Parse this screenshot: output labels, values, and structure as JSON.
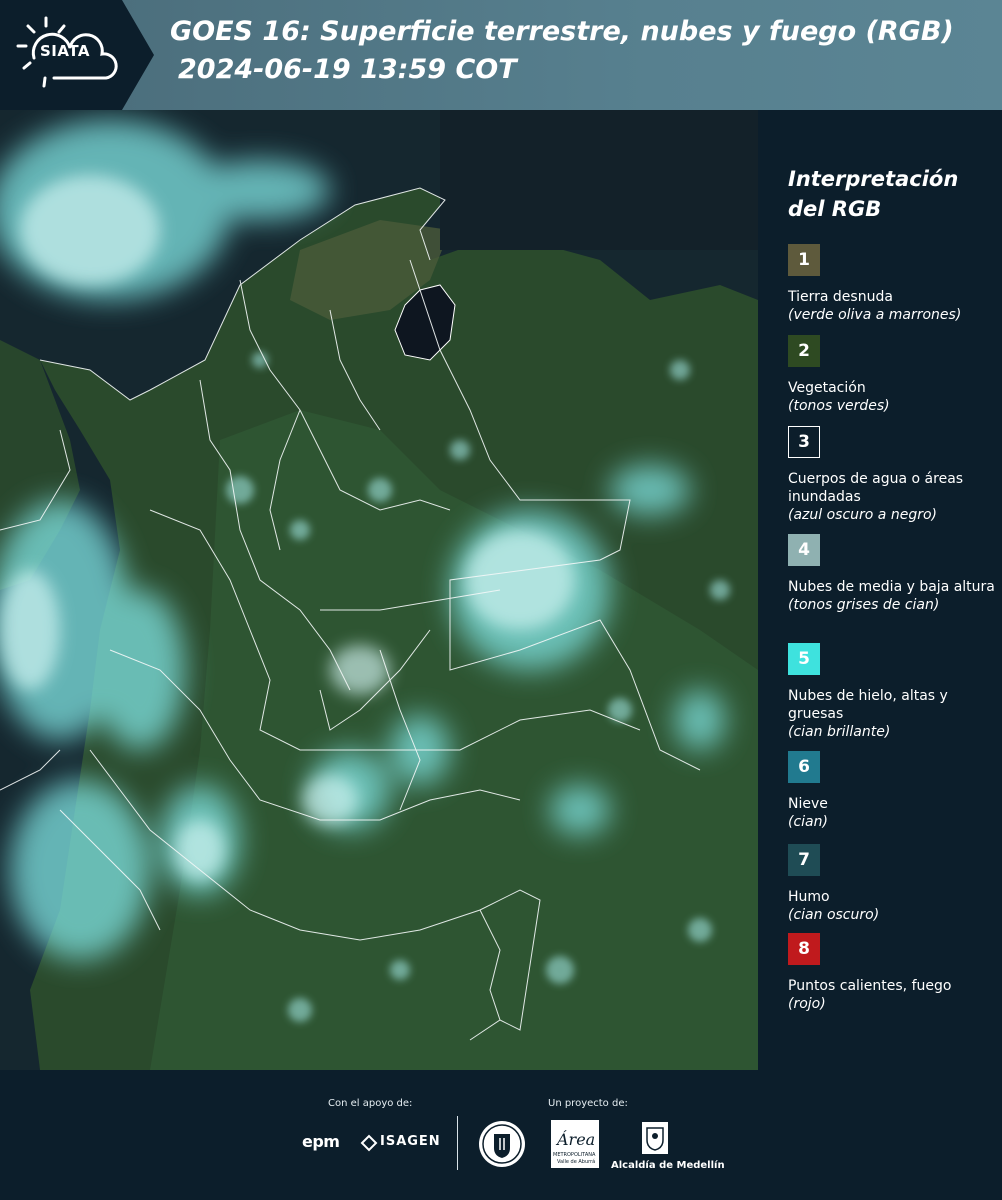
{
  "header": {
    "logo_text": "SIATA",
    "title_line1": "GOES 16: Superficie terrestre, nubes y fuego (RGB)",
    "title_line2": "2024-06-19 13:59 COT"
  },
  "legend": {
    "title": "Interpretación del RGB",
    "items": [
      {
        "num": "1",
        "label": "Tierra desnuda",
        "sub": "(verde oliva a marrones)",
        "color": "#5e5a3c"
      },
      {
        "num": "2",
        "label": "Vegetación",
        "sub": "(tonos verdes)",
        "color": "#2e4a22"
      },
      {
        "num": "3",
        "label": "Cuerpos de agua o áreas inundadas",
        "sub": "(azul oscuro a negro)",
        "color": "#0c1e2b"
      },
      {
        "num": "4",
        "label": "Nubes de media y baja altura",
        "sub": "(tonos grises de cian)",
        "color": "#8fb1b1"
      },
      {
        "num": "5",
        "label": "Nubes de hielo, altas y gruesas",
        "sub": "(cian brillante)",
        "color": "#3ee2de"
      },
      {
        "num": "6",
        "label": "Nieve",
        "sub": "(cian)",
        "color": "#217a8f"
      },
      {
        "num": "7",
        "label": "Humo",
        "sub": "(cian oscuro)",
        "color": "#1f4c55"
      },
      {
        "num": "8",
        "label": "Puntos calientes, fuego",
        "sub": "(rojo)",
        "color": "#c01a1d"
      }
    ]
  },
  "footer": {
    "support_label": "Con el apoyo de:",
    "project_label": "Un proyecto de:",
    "epm": "epm",
    "isagen": "ISAGEN",
    "area_text": "Área",
    "area_sub": "METROPOLITANA",
    "area_sub2": "Valle de Aburrá",
    "alcaldia": "Alcaldía de Medellín"
  }
}
